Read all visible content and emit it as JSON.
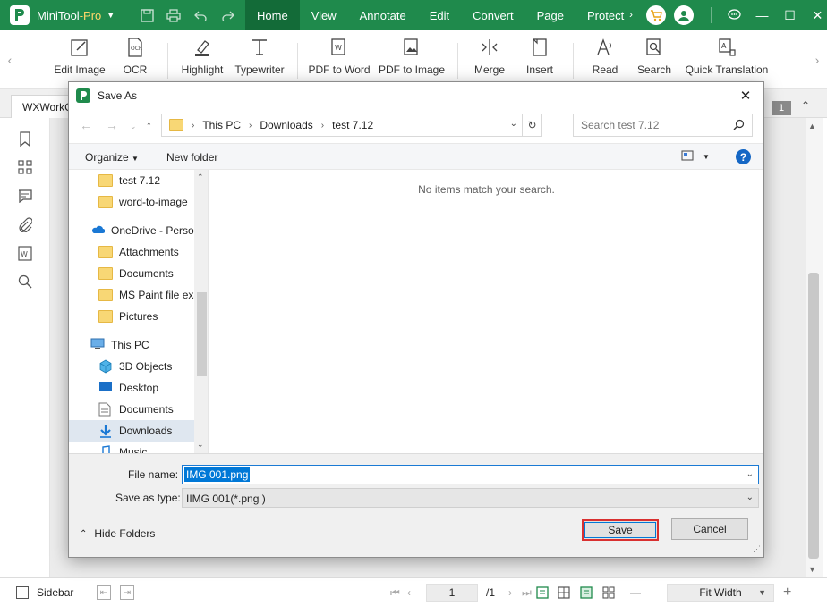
{
  "app": {
    "name": "MiniTool",
    "name_suffix": "-Pro",
    "menu_tabs": [
      "Home",
      "View",
      "Annotate",
      "Edit",
      "Convert",
      "Page",
      "Protect"
    ],
    "active_tab": "Home",
    "brand_color": "#1f8a4c"
  },
  "ribbon": {
    "items": [
      {
        "label": "Edit Image",
        "icon": "edit-image-icon"
      },
      {
        "label": "OCR",
        "icon": "ocr-icon"
      },
      {
        "label": "Highlight",
        "icon": "highlight-icon"
      },
      {
        "label": "Typewriter",
        "icon": "typewriter-icon"
      },
      {
        "label": "PDF to Word",
        "icon": "pdf-to-word-icon"
      },
      {
        "label": "PDF to Image",
        "icon": "pdf-to-image-icon"
      },
      {
        "label": "Merge",
        "icon": "merge-icon"
      },
      {
        "label": "Insert",
        "icon": "insert-icon"
      },
      {
        "label": "Read",
        "icon": "read-aloud-icon"
      },
      {
        "label": "Search",
        "icon": "search-icon"
      },
      {
        "label": "Quick Translation",
        "icon": "translate-icon"
      }
    ]
  },
  "document": {
    "tab_label": "WXWorkC",
    "page_count_badge": "1"
  },
  "statusbar": {
    "sidebar_label": "Sidebar",
    "current_page": "1",
    "total_pages": "/1",
    "zoom": "Fit Width"
  },
  "dialog": {
    "title": "Save As",
    "breadcrumb": [
      "This PC",
      "Downloads",
      "test 7.12"
    ],
    "search_placeholder": "Search test 7.12",
    "organize_label": "Organize",
    "new_folder_label": "New folder",
    "empty_message": "No items match your search.",
    "tree": [
      {
        "label": "test 7.12",
        "icon": "folder-icon",
        "indent": 1
      },
      {
        "label": "word-to-image",
        "icon": "folder-icon",
        "indent": 1
      },
      {
        "label": "OneDrive - Person",
        "icon": "onedrive-icon",
        "indent": 0
      },
      {
        "label": "Attachments",
        "icon": "folder-icon",
        "indent": 1
      },
      {
        "label": "Documents",
        "icon": "folder-icon",
        "indent": 1
      },
      {
        "label": "MS Paint file exa",
        "icon": "folder-icon",
        "indent": 1
      },
      {
        "label": "Pictures",
        "icon": "folder-icon",
        "indent": 1
      },
      {
        "label": "This PC",
        "icon": "computer-icon",
        "indent": 0
      },
      {
        "label": "3D Objects",
        "icon": "3d-objects-icon",
        "indent": 1
      },
      {
        "label": "Desktop",
        "icon": "desktop-icon",
        "indent": 1
      },
      {
        "label": "Documents",
        "icon": "documents-icon",
        "indent": 1
      },
      {
        "label": "Downloads",
        "icon": "downloads-icon",
        "indent": 1,
        "selected": true
      },
      {
        "label": "Music",
        "icon": "music-icon",
        "indent": 1
      }
    ],
    "file_name_label": "File name:",
    "file_name_value": "IMG 001.png",
    "save_type_label": "Save as type:",
    "save_type_value": "IIMG 001(*.png )",
    "hide_folders_label": "Hide Folders",
    "save_label": "Save",
    "cancel_label": "Cancel",
    "highlight_color": "#d93030"
  }
}
